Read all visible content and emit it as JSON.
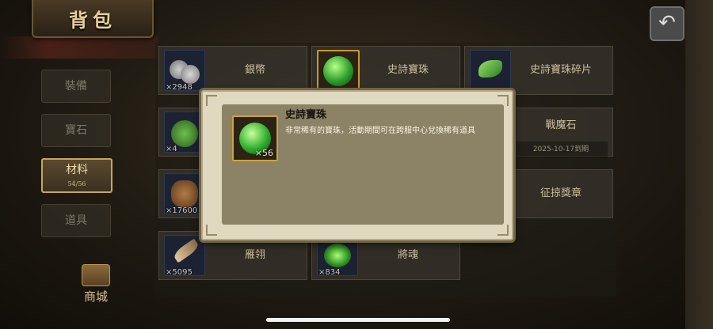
{
  "header": {
    "title": "背包"
  },
  "nav": {
    "back_icon": "back-arrow-icon"
  },
  "sidebar": {
    "tabs": [
      {
        "label": "裝備",
        "sub": "",
        "active": false
      },
      {
        "label": "寶石",
        "sub": "",
        "active": false
      },
      {
        "label": "材料",
        "sub": "54/56",
        "active": true
      },
      {
        "label": "道具",
        "sub": "",
        "active": false
      }
    ],
    "shop_label": "商城"
  },
  "items": [
    {
      "name": "銀幣",
      "count": "×2948",
      "icon": "silver-coins-icon"
    },
    {
      "name": "史詩寶珠",
      "count": "×56",
      "icon": "epic-orb-icon"
    },
    {
      "name": "史詩寶珠碎片",
      "count": "",
      "icon": "green-shard-icon"
    },
    {
      "name": "",
      "count": "×4",
      "icon": "green-pouch-icon"
    },
    {
      "name": "戰魔石",
      "count": "",
      "icon": "war-stone-icon",
      "expire": "2025-10-17到期"
    },
    {
      "name": "",
      "count": "×17600",
      "icon": "leather-bag-icon"
    },
    {
      "name": "征掠獎章",
      "count": "",
      "icon": "medal-icon"
    },
    {
      "name": "雁翎",
      "count": "×5095",
      "icon": "feather-icon"
    },
    {
      "name": "將魂",
      "count": "×834",
      "icon": "general-soul-icon"
    }
  ],
  "popup": {
    "title": "史詩寶珠",
    "description": "非常稀有的寶珠，活動期間可在跨服中心兌換稀有道具",
    "count": "×56",
    "icon": "epic-orb-icon"
  }
}
